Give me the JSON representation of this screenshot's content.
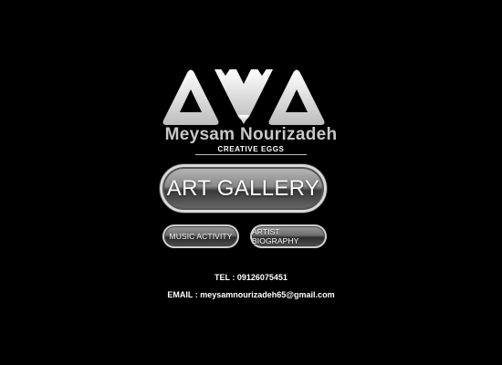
{
  "brand": {
    "name": "Meysam Nourizadeh",
    "tagline": "CREATIVE EGGS",
    "logo_icon": "ava-monogram-logo"
  },
  "nav": {
    "art_gallery": "ART GALLERY",
    "music_activity": "MUSIC ACTIVITY",
    "artist_biography": "ARTIST BIOGRAPHY"
  },
  "contact": {
    "tel": "TEL : 09126075451",
    "email": "EMAIL : meysamnourizadeh65@gmail.com"
  },
  "colors": {
    "background": "#000000",
    "text": "#ffffff",
    "brand_text": "#c8c8c8"
  }
}
